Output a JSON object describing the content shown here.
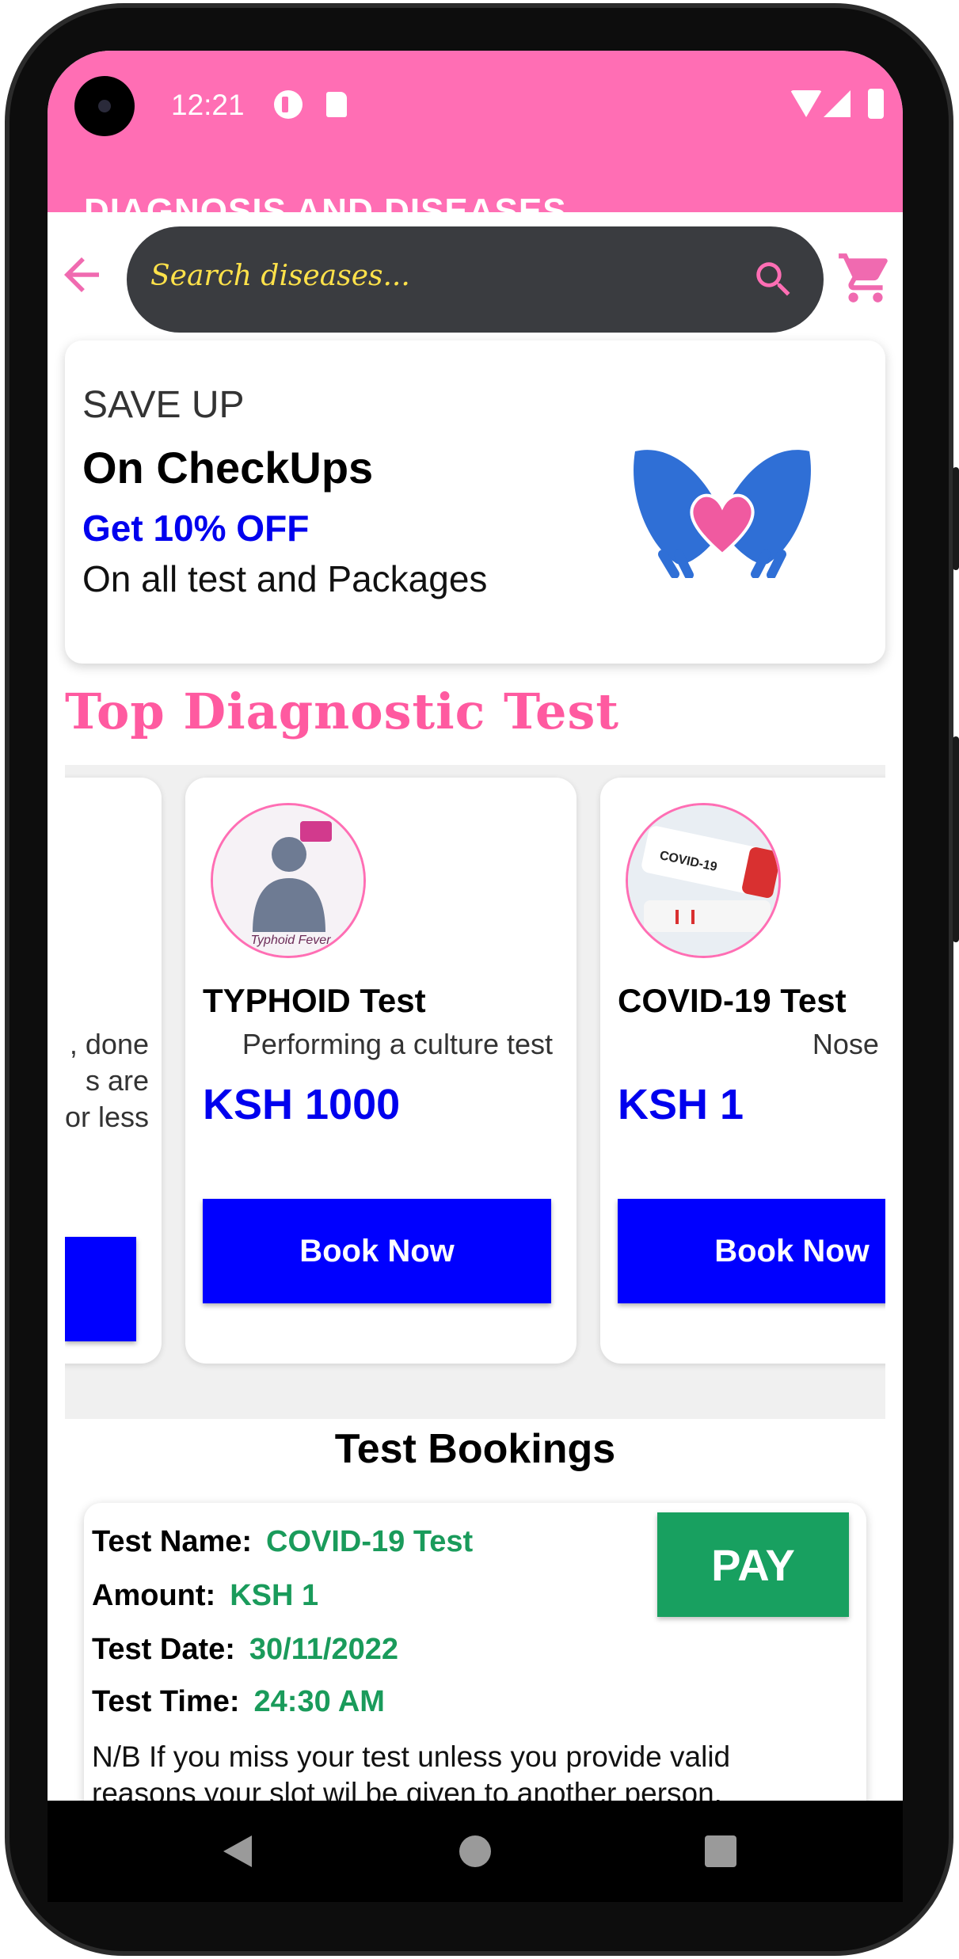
{
  "status_bar": {
    "time": "12:21"
  },
  "app_bar": {
    "title": "DIAGNOSIS AND DISEASES"
  },
  "search": {
    "placeholder": "Search diseases..."
  },
  "promo": {
    "line1": "SAVE UP",
    "line2": "On CheckUps",
    "line3": "Get 10% OFF",
    "line4": "On all test and Packages"
  },
  "section_title": "Top Diagnostic Test",
  "tests": [
    {
      "name": "",
      "desc_lines": [
        ", done",
        "s are",
        "or less"
      ],
      "price": "",
      "book_label": ""
    },
    {
      "name": "TYPHOID Test",
      "desc": "Performing a culture test",
      "price": "KSH 1000",
      "book_label": "Book Now",
      "avatar_caption": "Typhoid Fever"
    },
    {
      "name": "COVID-19 Test",
      "desc": "Nose swabs",
      "price": "KSH 1",
      "book_label": "Book Now",
      "avatar_caption": "COVID-19"
    }
  ],
  "bookings": {
    "title": "Test Bookings",
    "name_label": "Test Name:",
    "name_value": "COVID-19 Test",
    "amount_label": "Amount:",
    "amount_value": "KSH 1",
    "date_label": "Test Date:",
    "date_value": "30/11/2022",
    "time_label": "Test Time:",
    "time_value": "24:30 AM",
    "pay_label": "PAY",
    "note": "N/B  If you miss your test unless you provide valid reasons your slot wil be given to another person."
  },
  "colors": {
    "appbar": "#ff6eb4",
    "accent_blue": "#0000ff",
    "pay_green": "#18a060",
    "search_text": "#ffe24a"
  },
  "icons": {
    "back": "arrow-left-icon",
    "search": "search-icon",
    "cart": "cart-icon",
    "promo": "heart-hands-icon"
  }
}
